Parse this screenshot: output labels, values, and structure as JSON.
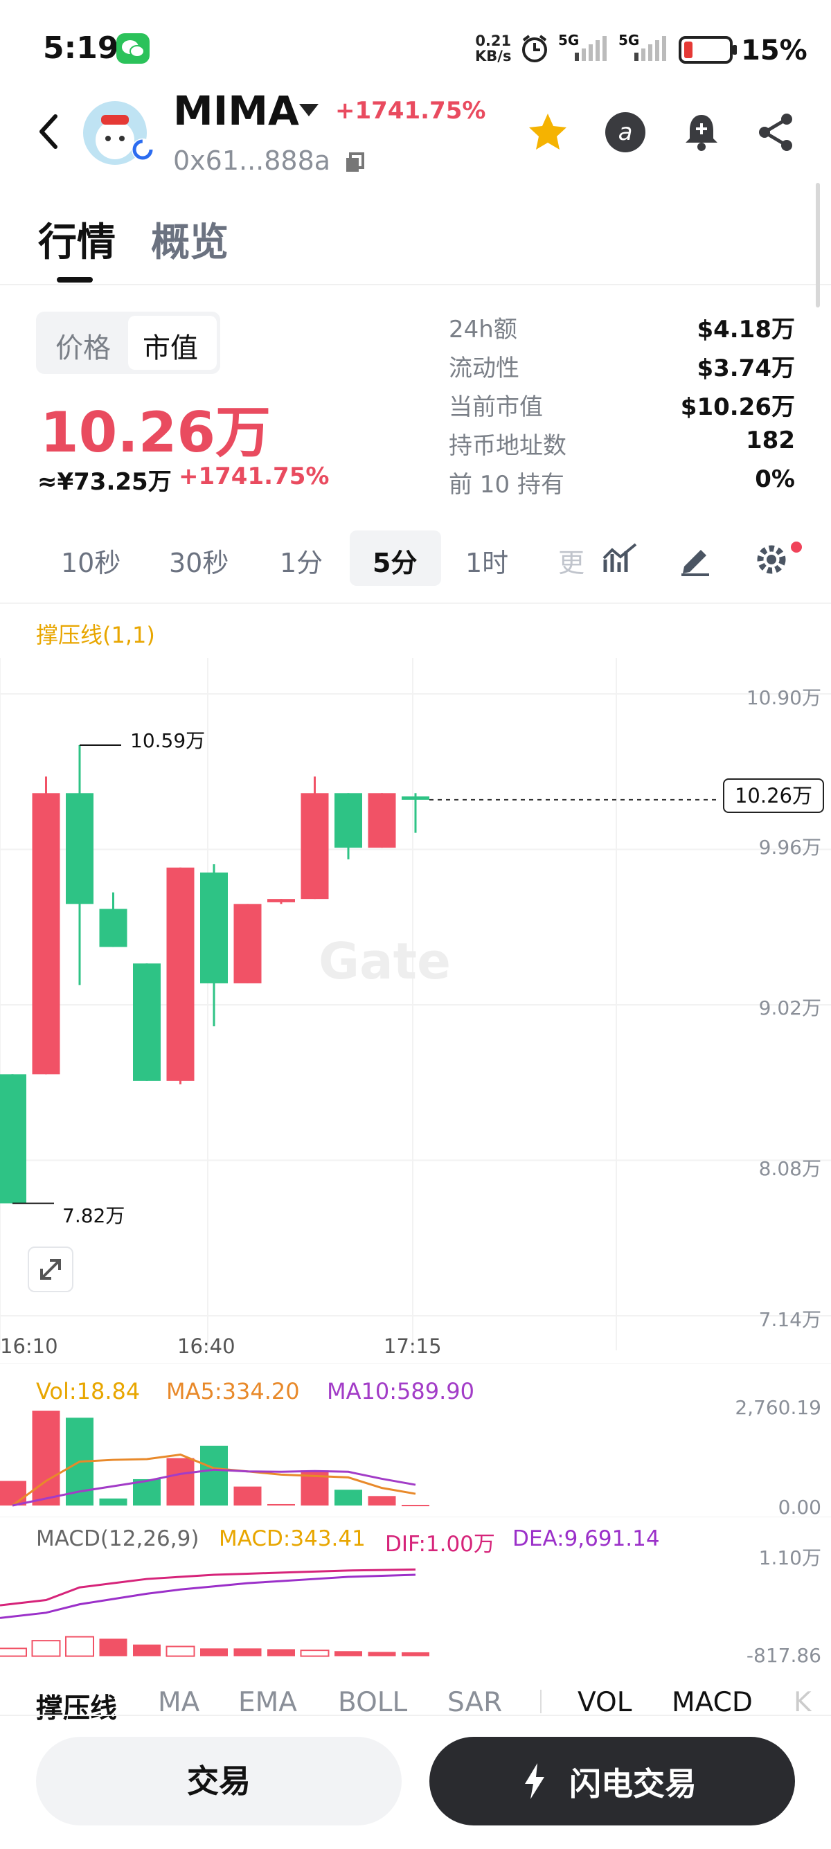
{
  "status_bar": {
    "time": "5:19",
    "net_speed_value": "0.21",
    "net_speed_unit": "KB/s",
    "signal_1": "5G",
    "signal_2": "5G",
    "battery_pct": "15%",
    "icons": [
      "wechat-icon",
      "alarm-icon",
      "signal-icon",
      "battery-icon"
    ]
  },
  "header": {
    "token_name": "MIMA",
    "change_pct": "+1741.75%",
    "address": "0x61...888a",
    "icons": [
      "back-icon",
      "star-icon",
      "at-icon",
      "bell-add-icon",
      "share-icon"
    ],
    "star_color": "#f5b301"
  },
  "tabs": [
    {
      "label": "行情",
      "active": true
    },
    {
      "label": "概览",
      "active": false
    }
  ],
  "price_panel": {
    "toggle": [
      "价格",
      "市值"
    ],
    "toggle_selected": "市值",
    "main_value": "10.26万",
    "cny_value": "≈¥73.25万",
    "change_pct": "+1741.75%",
    "stats": [
      {
        "label": "24h额",
        "value": "$4.18万"
      },
      {
        "label": "流动性",
        "value": "$3.74万"
      },
      {
        "label": "当前市值",
        "value": "$10.26万"
      },
      {
        "label": "持币地址数",
        "value": "182"
      },
      {
        "label": "前 10 持有",
        "value": "0%"
      }
    ]
  },
  "intervals": {
    "items": [
      "10秒",
      "30秒",
      "1分",
      "5分",
      "1时",
      "更"
    ],
    "active": "5分",
    "tool_icons": [
      "indicator-icon",
      "draw-icon",
      "settings-icon"
    ]
  },
  "chart_overlay_label": "撑压线(1,1)",
  "chart_data": {
    "type": "candlestick",
    "y_axis_labels": [
      "10.90万",
      "9.96万",
      "9.02万",
      "8.08万",
      "7.14万"
    ],
    "ylim": [
      7.14,
      10.9
    ],
    "x_axis_labels": [
      "16:10",
      "16:40",
      "17:15"
    ],
    "current_price_label": "10.26万",
    "current_price": 10.26,
    "high_label": "10.59万",
    "low_label": "7.82万",
    "up_color": "#f15266",
    "down_color": "#2ec385",
    "watermark": "Gate",
    "candles": [
      {
        "o": 8.6,
        "h": 8.6,
        "l": 7.82,
        "c": 7.82
      },
      {
        "o": 8.6,
        "h": 10.4,
        "l": 8.6,
        "c": 10.3
      },
      {
        "o": 10.3,
        "h": 10.59,
        "l": 9.14,
        "c": 9.63
      },
      {
        "o": 9.6,
        "h": 9.7,
        "l": 9.37,
        "c": 9.37
      },
      {
        "o": 9.27,
        "h": 9.27,
        "l": 8.56,
        "c": 8.56
      },
      {
        "o": 8.56,
        "h": 9.85,
        "l": 8.54,
        "c": 9.85
      },
      {
        "o": 9.82,
        "h": 9.87,
        "l": 8.89,
        "c": 9.15
      },
      {
        "o": 9.15,
        "h": 9.63,
        "l": 9.15,
        "c": 9.63
      },
      {
        "o": 9.64,
        "h": 9.66,
        "l": 9.63,
        "c": 9.66
      },
      {
        "o": 9.66,
        "h": 10.4,
        "l": 9.66,
        "c": 10.3
      },
      {
        "o": 10.3,
        "h": 10.3,
        "l": 9.9,
        "c": 9.97
      },
      {
        "o": 9.97,
        "h": 10.3,
        "l": 9.97,
        "c": 10.3
      },
      {
        "o": 10.28,
        "h": 10.3,
        "l": 10.06,
        "c": 10.26
      }
    ]
  },
  "volume_panel": {
    "vol_label": "Vol:18.84",
    "ma5_label": "MA5:334.20",
    "ma10_label": "MA10:589.90",
    "y_top": "2,760.19",
    "y_bottom": "0.00",
    "ylim": [
      0,
      2760.19
    ],
    "vol_color": "#e8a600",
    "ma5_color": "#e8892a",
    "ma10_color": "#a23cc7",
    "volumes": [
      700,
      2700,
      2500,
      200,
      750,
      1350,
      1700,
      540,
      40,
      1000,
      450,
      270,
      19
    ],
    "up": [
      true,
      true,
      false,
      false,
      false,
      true,
      false,
      true,
      true,
      true,
      false,
      true,
      true
    ],
    "ma5": [
      0,
      700,
      1250,
      1300,
      1320,
      1450,
      1060,
      970,
      880,
      840,
      800,
      500,
      334
    ],
    "ma10": [
      0,
      200,
      400,
      550,
      700,
      900,
      1020,
      970,
      960,
      980,
      960,
      760,
      590
    ]
  },
  "macd_panel": {
    "title": "MACD(12,26,9)",
    "macd_label": "MACD:343.41",
    "dif_label": "DIF:1.00万",
    "dea_label": "DEA:9,691.14",
    "y_top": "1.10万",
    "y_bottom": "-817.86",
    "ylim": [
      -817.86,
      11000
    ],
    "macd_color": "#e8a600",
    "dif_color": "#d6247a",
    "dea_color": "#9b30c9",
    "hist": [
      -200,
      -400,
      -500,
      -450,
      -300,
      -250,
      -200,
      -200,
      -180,
      -150,
      -130,
      -110,
      -100
    ],
    "hist_up": [
      false,
      false,
      false,
      true,
      true,
      false,
      true,
      true,
      true,
      false,
      true,
      true,
      true
    ],
    "dif": [
      3900,
      4400,
      5600,
      6000,
      6400,
      6600,
      6800,
      6900,
      7000,
      7100,
      7200,
      7250,
      7300
    ],
    "dea": [
      2700,
      3200,
      4000,
      4500,
      5000,
      5400,
      5700,
      6000,
      6200,
      6400,
      6600,
      6700,
      6800
    ]
  },
  "indicator_tabs": {
    "items": [
      "撑压线",
      "MA",
      "EMA",
      "BOLL",
      "SAR",
      "VOL",
      "MACD",
      "K"
    ],
    "active": [
      "撑压线",
      "VOL",
      "MACD"
    ]
  },
  "actions": {
    "trade": "交易",
    "flash_trade": "闪电交易"
  }
}
